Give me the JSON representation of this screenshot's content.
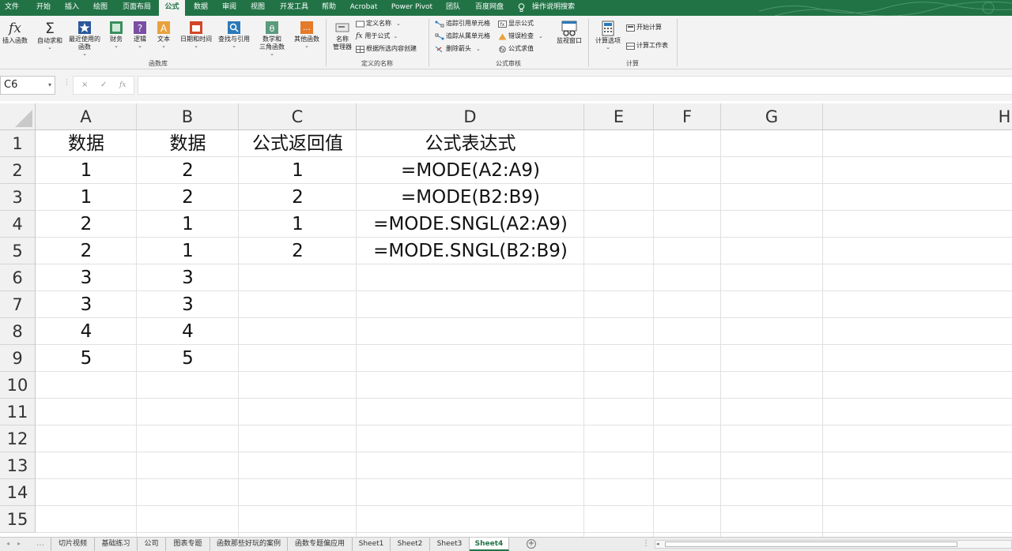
{
  "menu": {
    "tabs": [
      "文件",
      "开始",
      "插入",
      "绘图",
      "页面布局",
      "公式",
      "数据",
      "审阅",
      "视图",
      "开发工具",
      "帮助",
      "Acrobat",
      "Power Pivot",
      "团队",
      "百度网盘",
      "操作说明搜索"
    ],
    "active": "公式"
  },
  "ribbon": {
    "insert_function": "插入函数",
    "autosum": "自动求和",
    "recent_1": "最近使用的",
    "recent_2": "函数",
    "financial": "财务",
    "logical": "逻辑",
    "text": "文本",
    "datetime": "日期和时间",
    "lookup": "查找与引用",
    "math_1": "数学和",
    "math_2": "三角函数",
    "other": "其他函数",
    "group_library": "函数库",
    "name_manager_1": "名称",
    "name_manager_2": "管理器",
    "define_name": "定义名称",
    "use_in_formula": "用于公式",
    "create_from_selection": "根据所选内容创建",
    "group_names": "定义的名称",
    "trace_precedents": "追踪引用单元格",
    "trace_dependents": "追踪从属单元格",
    "remove_arrows": "删除箭头",
    "show_formulas": "显示公式",
    "error_checking": "错误检查",
    "evaluate_formula": "公式求值",
    "watch_window": "监视窗口",
    "group_audit": "公式审核",
    "calc_options": "计算选项",
    "calc_now": "开始计算",
    "calc_sheet": "计算工作表",
    "group_calc": "计算"
  },
  "formula_bar": {
    "name_box": "C6",
    "cancel": "×",
    "enter": "✓",
    "fx": "fx",
    "content": ""
  },
  "grid": {
    "columns": [
      "A",
      "B",
      "C",
      "D",
      "E",
      "F",
      "G",
      "H"
    ],
    "rows": [
      "1",
      "2",
      "3",
      "4",
      "5",
      "6",
      "7",
      "8",
      "9",
      "10",
      "11",
      "12",
      "13",
      "14",
      "15"
    ],
    "cells": {
      "A1": "数据",
      "B1": "数据",
      "C1": "公式返回值",
      "D1": "公式表达式",
      "A2": "1",
      "B2": "2",
      "C2": "1",
      "D2": "=MODE(A2:A9)",
      "A3": "1",
      "B3": "2",
      "C3": "2",
      "D3": "=MODE(B2:B9)",
      "A4": "2",
      "B4": "1",
      "C4": "1",
      "D4": "=MODE.SNGL(A2:A9)",
      "A5": "2",
      "B5": "1",
      "C5": "2",
      "D5": "=MODE.SNGL(B2:B9)",
      "A6": "3",
      "B6": "3",
      "A7": "3",
      "B7": "3",
      "A8": "4",
      "B8": "4",
      "A9": "5",
      "B9": "5"
    }
  },
  "sheet_tabs": {
    "items": [
      "切片视频",
      "基础练习",
      "公司",
      "图表专题",
      "函数那些好玩的案例",
      "函数专题偏应用",
      "Sheet1",
      "Sheet2",
      "Sheet3",
      "Sheet4"
    ],
    "active": "Sheet4"
  },
  "colors": {
    "brand": "#217346",
    "ribbon_bg": "#f3f3f3"
  }
}
